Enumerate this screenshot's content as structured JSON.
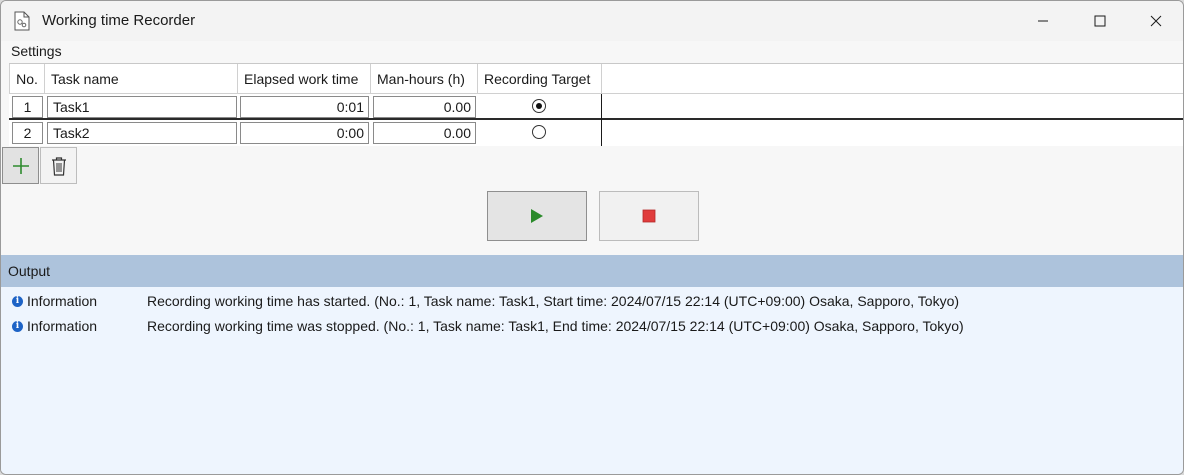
{
  "window": {
    "title": "Working time Recorder"
  },
  "settings": {
    "label": "Settings"
  },
  "grid": {
    "columns": [
      "No.",
      "Task name",
      "Elapsed work time",
      "Man-hours (h)",
      "Recording Target"
    ],
    "rows": [
      {
        "no": "1",
        "name": "Task1",
        "elapsed": "0:01",
        "hours": "0.00",
        "target": true
      },
      {
        "no": "2",
        "name": "Task2",
        "elapsed": "0:00",
        "hours": "0.00",
        "target": false
      }
    ]
  },
  "controls": {
    "add_icon": "plus-icon",
    "delete_icon": "trash-icon",
    "play_icon": "play-icon",
    "stop_icon": "stop-icon",
    "play_color": "#2a8a2a",
    "stop_color": "#e03c3c"
  },
  "output": {
    "title": "Output",
    "entries": [
      {
        "level": "Information",
        "message": "Recording working time has started. (No.: 1, Task name: Task1, Start time: 2024/07/15 22:14 (UTC+09:00) Osaka, Sapporo, Tokyo)"
      },
      {
        "level": "Information",
        "message": "Recording working time was stopped. (No.: 1, Task name: Task1, End time: 2024/07/15 22:14 (UTC+09:00) Osaka, Sapporo, Tokyo)"
      }
    ]
  },
  "colors": {
    "output_header": "#adc3dc",
    "output_body": "#eef5fe",
    "info_icon": "#1d63c6"
  }
}
